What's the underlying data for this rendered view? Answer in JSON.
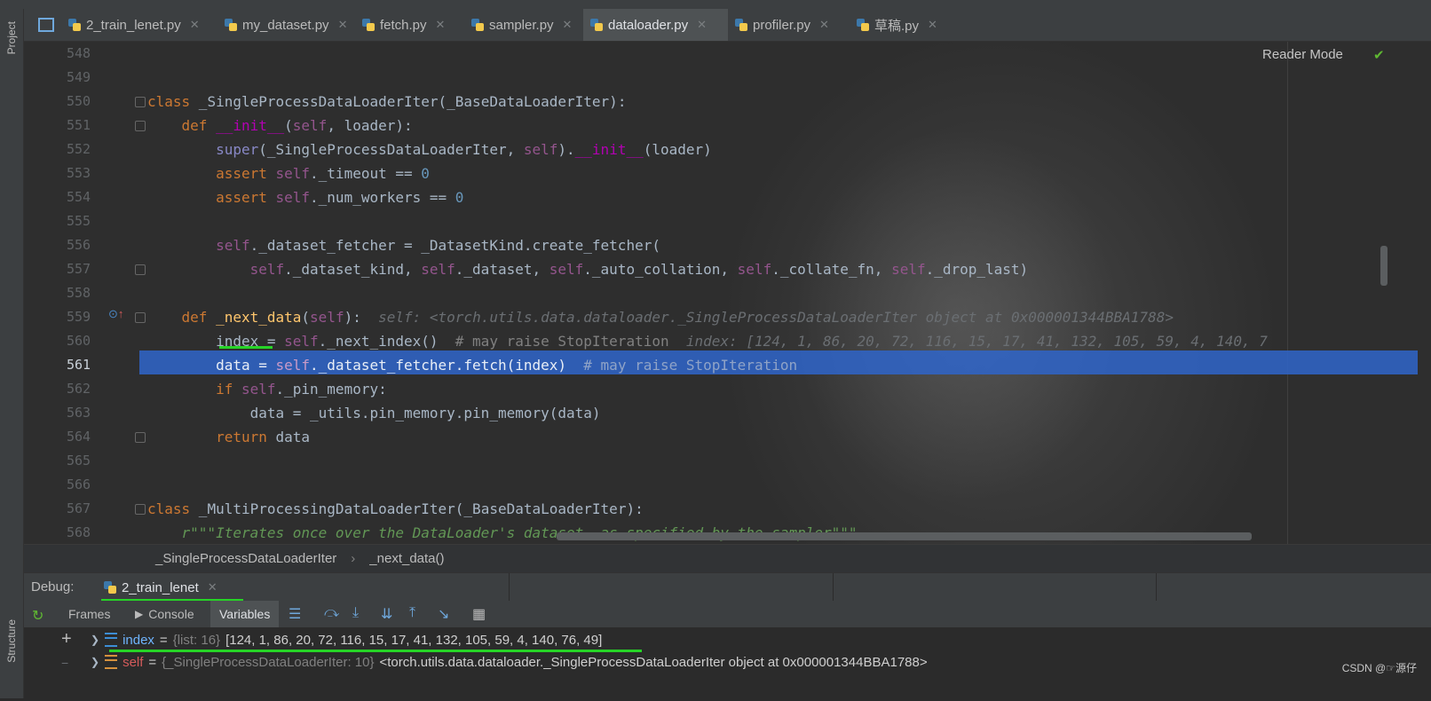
{
  "left_strip": {
    "project_label": "Project",
    "structure_label": "Structure"
  },
  "tabs": [
    {
      "label": "2_train_lenet.py"
    },
    {
      "label": "my_dataset.py"
    },
    {
      "label": "fetch.py"
    },
    {
      "label": "sampler.py"
    },
    {
      "label": "dataloader.py",
      "active": true
    },
    {
      "label": "profiler.py"
    },
    {
      "label": "草稿.py"
    }
  ],
  "editor": {
    "reader_mode": "Reader Mode",
    "lines": [
      {
        "n": "548"
      },
      {
        "n": "549"
      },
      {
        "n": "550"
      },
      {
        "n": "551"
      },
      {
        "n": "552"
      },
      {
        "n": "553"
      },
      {
        "n": "554"
      },
      {
        "n": "555"
      },
      {
        "n": "556"
      },
      {
        "n": "557"
      },
      {
        "n": "558"
      },
      {
        "n": "559"
      },
      {
        "n": "560"
      },
      {
        "n": "561"
      },
      {
        "n": "562"
      },
      {
        "n": "563"
      },
      {
        "n": "564"
      },
      {
        "n": "565"
      },
      {
        "n": "566"
      },
      {
        "n": "567"
      },
      {
        "n": "568"
      }
    ],
    "inline_559": "self: <torch.utils.data.dataloader._SingleProcessDataLoaderIter object at 0x000001344BBA1788>",
    "inline_560": "index: [124, 1, 86, 20, 72, 116, 15, 17, 41, 132, 105, 59, 4, 140, 7"
  },
  "breadcrumb": {
    "class_name": "_SingleProcessDataLoaderIter",
    "method_name": "_next_data()"
  },
  "debug": {
    "label": "Debug:",
    "session": "2_train_lenet",
    "tabs": {
      "frames": "Frames",
      "console": "Console",
      "variables": "Variables"
    },
    "variables": [
      {
        "name": "index",
        "type": "{list: 16}",
        "value": "[124, 1, 86, 20, 72, 116, 15, 17, 41, 132, 105, 59, 4, 140, 76, 49]"
      },
      {
        "name": "self",
        "type": "{_SingleProcessDataLoaderIter: 10}",
        "value": "<torch.utils.data.dataloader._SingleProcessDataLoaderIter object at 0x000001344BBA1788>"
      }
    ]
  },
  "watermark": "CSDN @☞源仔",
  "colors": {
    "highlight": "#2f65ca",
    "accent_underline": "#26d426",
    "keyword": "#cc7832",
    "self": "#94558d"
  }
}
